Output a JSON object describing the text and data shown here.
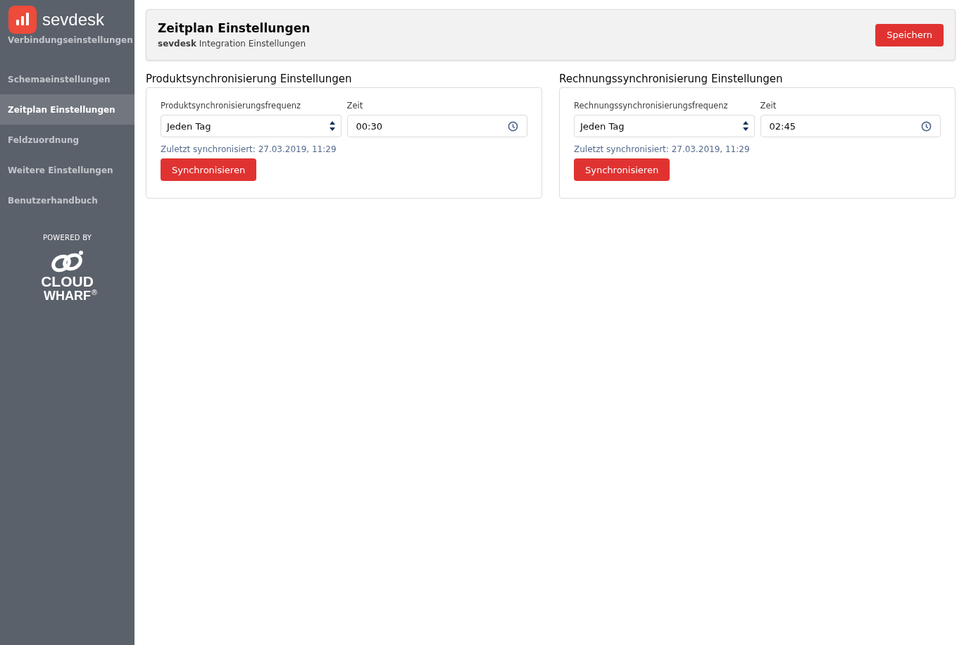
{
  "sidebar": {
    "brand": "sevdesk",
    "items": [
      {
        "label": "Verbindungseinstellungen",
        "selected": false
      },
      {
        "label": "Schemaeinstellungen",
        "selected": false
      },
      {
        "label": "Zeitplan Einstellungen",
        "selected": true
      },
      {
        "label": "Feldzuordnung",
        "selected": false
      },
      {
        "label": "Weitere Einstellungen",
        "selected": false
      },
      {
        "label": "Benutzerhandbuch",
        "selected": false
      }
    ],
    "powered_by": "POWERED BY",
    "partner_logo": {
      "line_1": "CLOUD",
      "line_2": "WHARF",
      "mark": "®"
    }
  },
  "header": {
    "title": "Zeitplan Einstellungen",
    "subtitle": "**sevdesk** Integration Einstellungen",
    "save_button": "Speichern"
  },
  "sections": [
    {
      "title": "Produktsynchronisierung Einstellungen",
      "frequency_label": "Produktsynchronisierungsfrequenz",
      "frequency_value": "Jeden Tag",
      "time_label": "Zeit",
      "time_value": "00:30",
      "last_sync": "Zuletzt synchronisiert: 27.03.2019, 11:29",
      "sync_button": "Synchronisieren"
    },
    {
      "title": "Rechnungssynchronisierung Einstellungen",
      "frequency_label": "Rechnungssynchronisierungsfrequenz",
      "frequency_value": "Jeden Tag",
      "time_label": "Zeit",
      "time_value": "02:45",
      "last_sync": "Zuletzt synchronisiert: 27.03.2019, 11:29",
      "sync_button": "Synchronisieren"
    }
  ]
}
